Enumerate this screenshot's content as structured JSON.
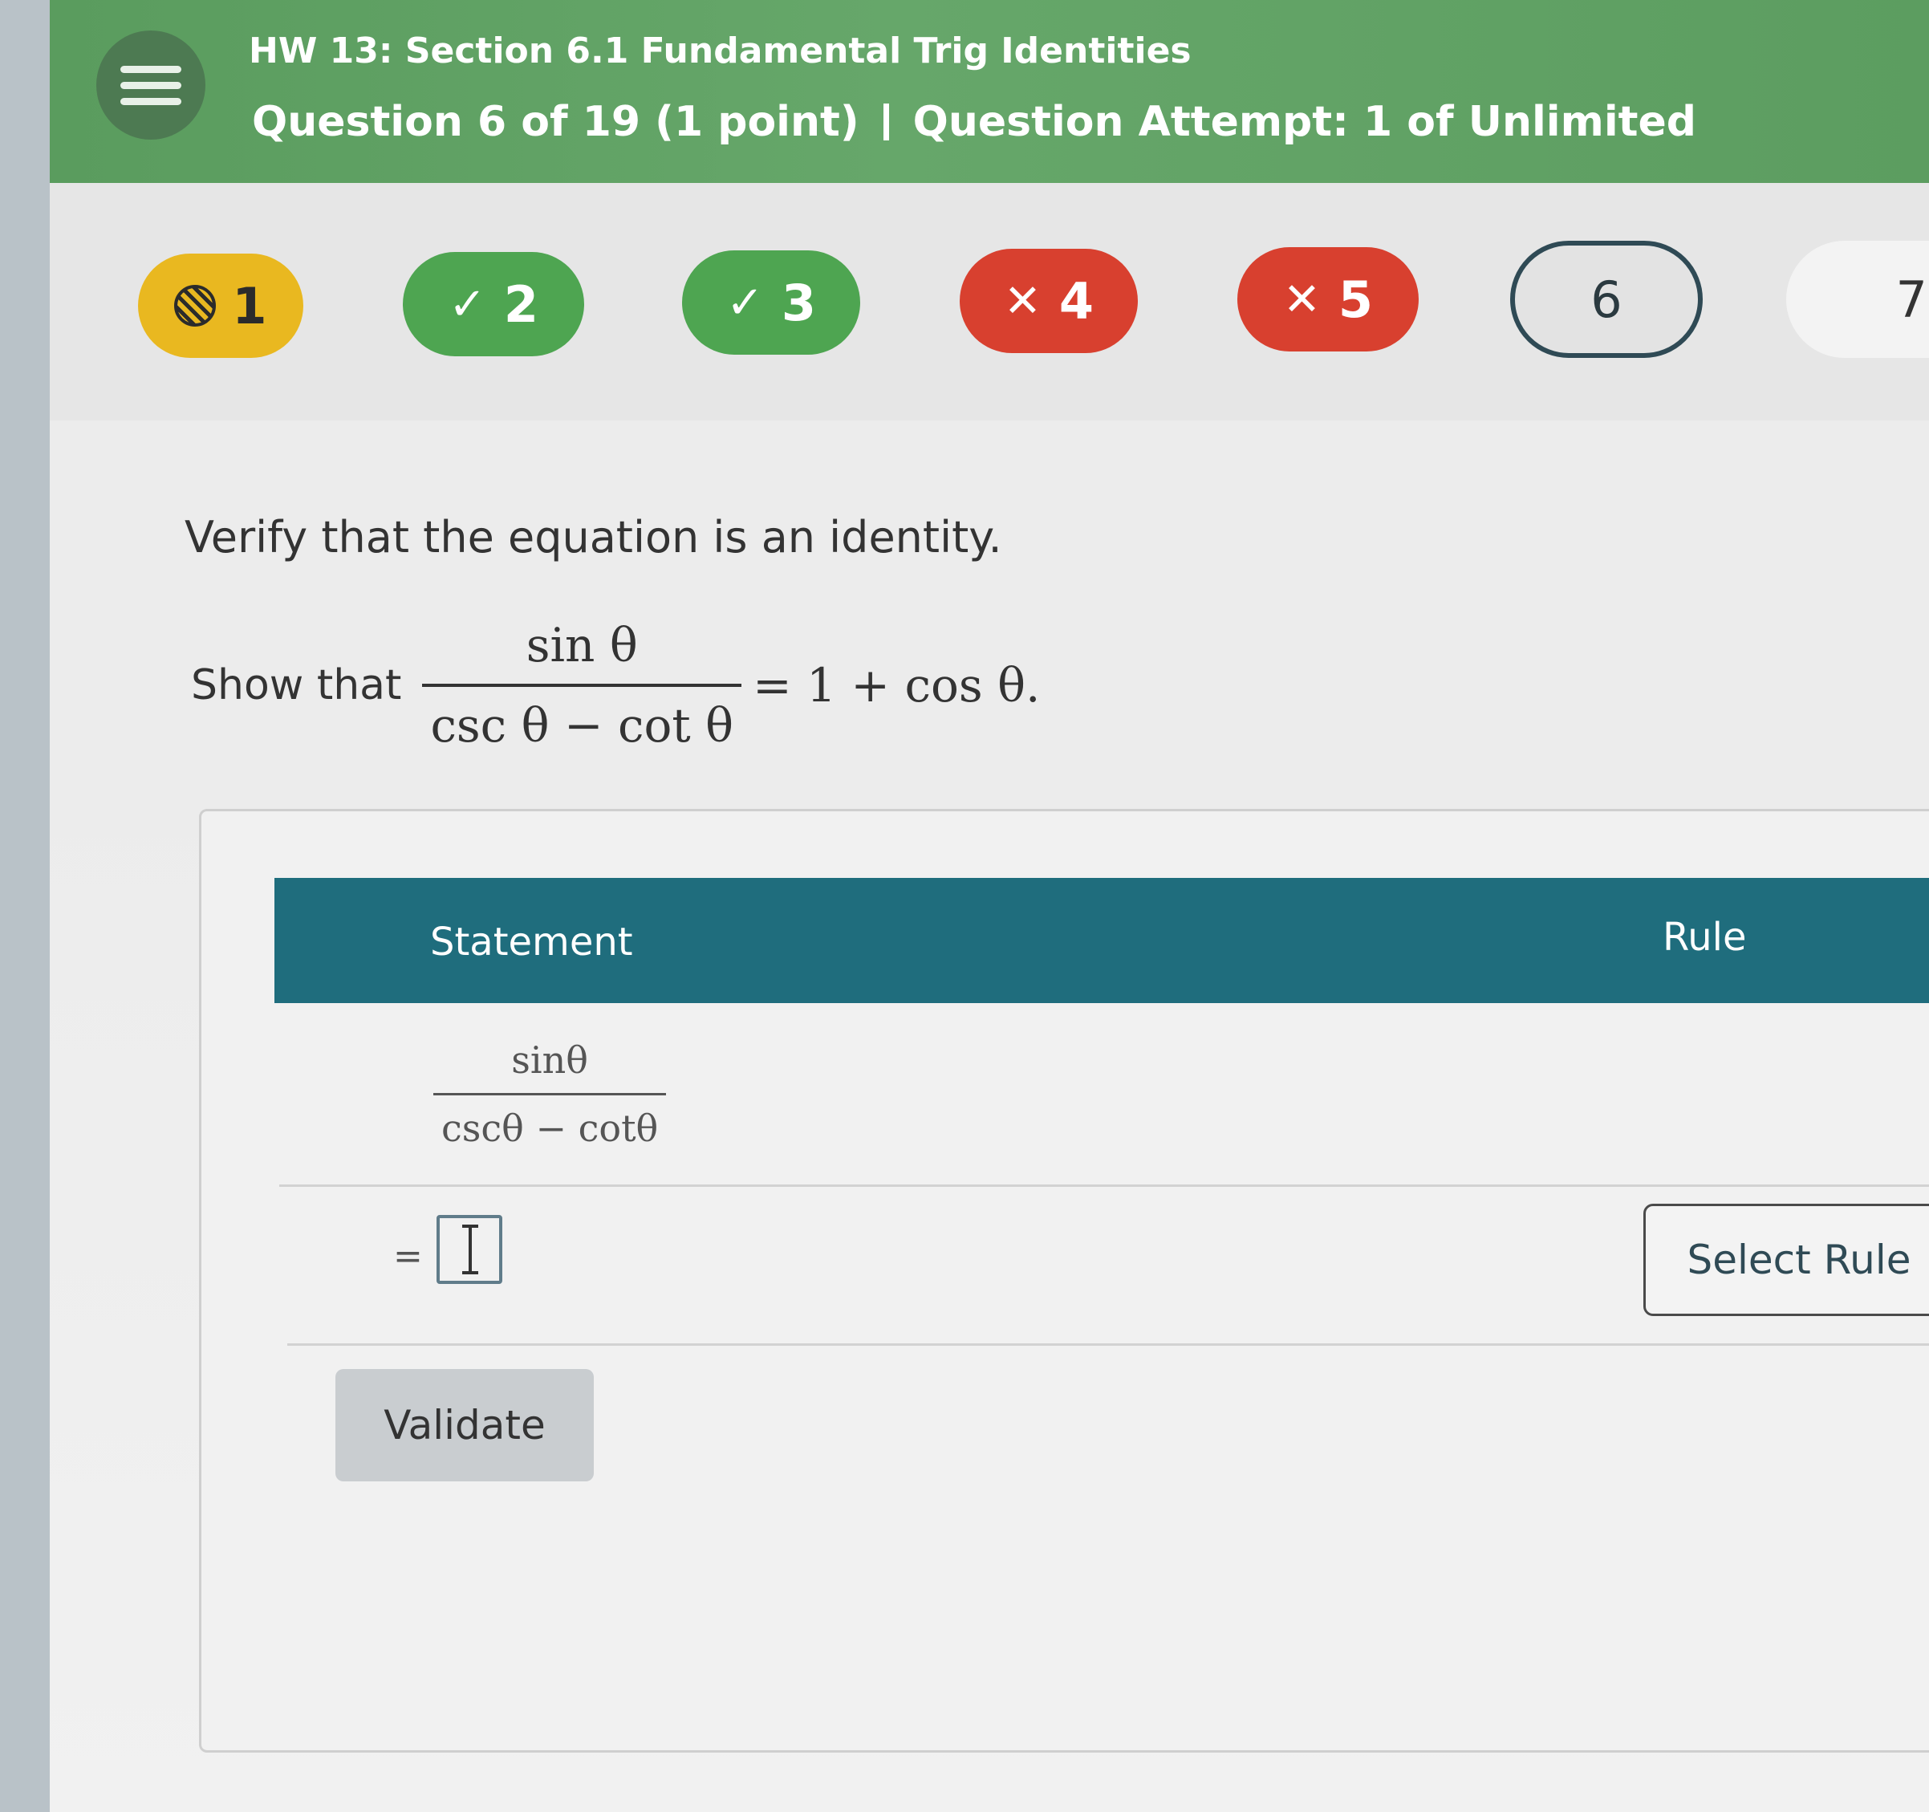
{
  "header": {
    "title": "HW 13: Section 6.1 Fundamental Trig Identities",
    "question": "Question 6 of 19 (1 point)",
    "attempt": "Question Attempt: 1 of Unlimited"
  },
  "question_nav": [
    {
      "label": "1",
      "status": "partial",
      "icon": "striped-circle-icon"
    },
    {
      "label": "2",
      "status": "correct",
      "icon": "check-icon",
      "glyph": "✓"
    },
    {
      "label": "3",
      "status": "correct",
      "icon": "check-icon",
      "glyph": "✓"
    },
    {
      "label": "4",
      "status": "incorrect",
      "icon": "x-icon",
      "glyph": "✕"
    },
    {
      "label": "5",
      "status": "incorrect",
      "icon": "x-icon",
      "glyph": "✕"
    },
    {
      "label": "6",
      "status": "current"
    },
    {
      "label": "7",
      "status": "unanswered"
    }
  ],
  "problem": {
    "prompt": "Verify that the equation is an identity.",
    "show_label": "Show that",
    "numerator": "sin θ",
    "denominator": "csc θ − cot θ",
    "rhs": "= 1 + cos θ."
  },
  "proof_table": {
    "col_statement": "Statement",
    "col_rule": "Rule",
    "first_numerator": "sinθ",
    "first_denominator": "cscθ − cotθ",
    "eq_sign": "=",
    "select_rule_label": "Select Rule"
  },
  "validate_label": "Validate",
  "colors": {
    "header_green": "#5f9f63",
    "table_header": "#1f6d7d",
    "partial": "#e9b820",
    "correct": "#4ea551",
    "incorrect": "#d8402f"
  }
}
